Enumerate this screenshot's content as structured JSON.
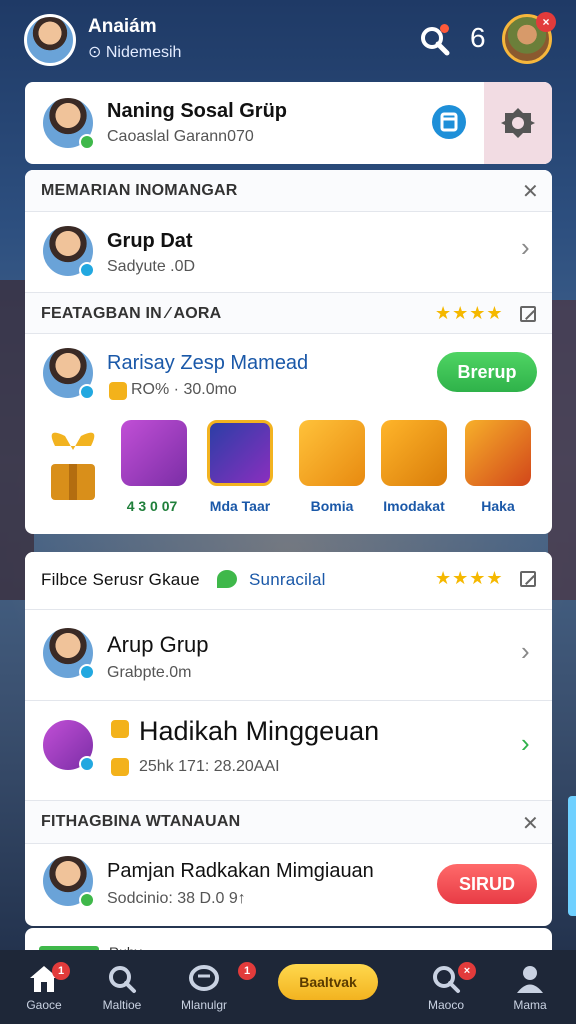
{
  "header": {
    "name": "Anaiám",
    "status": "⊙ Nidemesih",
    "count": "6",
    "avatar_badge": "×"
  },
  "group_card": {
    "title": "Naning Sosal Grüp",
    "subtitle": "Caoaslal Garann070"
  },
  "section1": {
    "title": "MEMARIAN INOMANGAR",
    "row": {
      "title": "Grup Dat",
      "subtitle": "Sadyute .0D"
    }
  },
  "section2": {
    "title": "FEATAGBAN IN ⁄ AORA",
    "stars": "★★★★",
    "row": {
      "title": "Rarisay Zesp Mamead",
      "subtitle": "RO% · 30.0mo",
      "button": "Brerup"
    },
    "items": [
      {
        "name": "gift-ribbon",
        "label": ""
      },
      {
        "name": "bag",
        "label": "4 3 0  07"
      },
      {
        "name": "dimd-card",
        "label": "Mda Taar"
      },
      {
        "name": "robot-mask",
        "label": "Bomia"
      },
      {
        "name": "scroll",
        "label": "Imodakat"
      },
      {
        "name": "chest",
        "label": "Haka"
      }
    ]
  },
  "section3": {
    "title": "Filbce Serusr Gkaue",
    "link": "Sunracilal",
    "stars": "★★★★",
    "rows": [
      {
        "title": "Arup Grup",
        "subtitle": "Grabpte.0m"
      },
      {
        "title": "Hadikah Minggeuan",
        "subtitle": "25hk 171: 28.20AAI"
      }
    ]
  },
  "section4": {
    "title": "FITHAGBINA WTANAUAN",
    "row": {
      "title": "Pamjan Radkakan Mimgiauan",
      "subtitle": "Sodcinio: 38 D.0 9↑",
      "button": "SIRUD"
    }
  },
  "card4": {
    "title": "Ruby"
  },
  "bottom_nav": {
    "items": [
      {
        "label": "Gaoce",
        "badge": "1"
      },
      {
        "label": "Maltioe"
      },
      {
        "label": "Mlanulgr",
        "badge": "1"
      },
      {
        "label": "Maoco"
      },
      {
        "label": "Mama"
      }
    ],
    "pill": "Baaltvak"
  },
  "colors": {
    "accent_green": "#2fb24a",
    "accent_red": "#e83b45",
    "link_blue": "#1a58a8"
  }
}
